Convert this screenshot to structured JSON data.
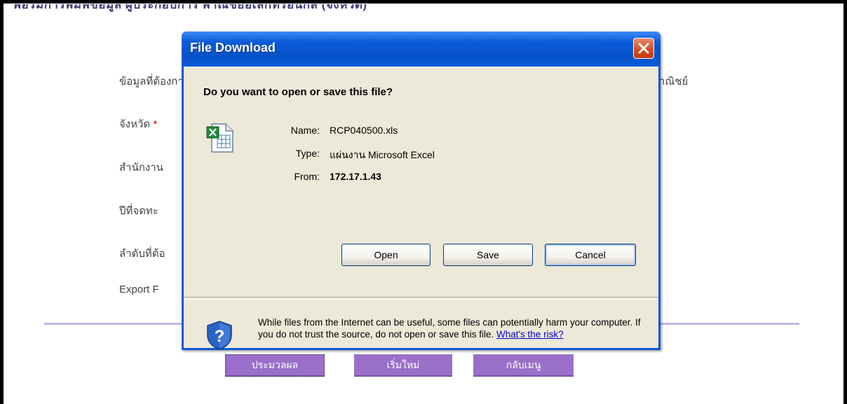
{
  "page": {
    "heading": "ฟอร์มการพิมพ์ข้อมูล ผู้ประกอบการ พาณิชย์อิเล็กทรอนิกส์ (จังหวัด)",
    "labels": {
      "data_source": "ข้อมูลที่ต้องการ",
      "province": "จังหวัด",
      "province_required": "*",
      "office": "สำนักงาน",
      "year": "ปีที่จดทะ",
      "sequence": "ลำดับที่ต้อ",
      "export": "Export F",
      "suffix": "าณิชย์"
    },
    "buttons": {
      "process": "ประมวลผล",
      "restart": "เริ่มใหม่",
      "back_menu": "กลับเมนู"
    }
  },
  "dialog": {
    "title": "File Download",
    "question": "Do you want to open or save this file?",
    "name_label": "Name:",
    "name_value": "RCP040500.xls",
    "type_label": "Type:",
    "type_value": "แผ่นงาน Microsoft Excel",
    "from_label": "From:",
    "from_value": "172.17.1.43",
    "open_label": "Open",
    "save_label": "Save",
    "cancel_label": "Cancel",
    "warning_text": "While files from the Internet can be useful, some files can potentially harm your computer. If you do not trust the source, do not open or save this file.",
    "risk_link": "What's the risk?",
    "icons": [
      "close-icon",
      "excel-file-icon",
      "shield-question-icon"
    ]
  },
  "colors": {
    "titlebar": "#0a5ad8",
    "dialog_body": "#ece9d8",
    "action_button": "#9a6fc9",
    "divider": "#c2b8e8"
  }
}
